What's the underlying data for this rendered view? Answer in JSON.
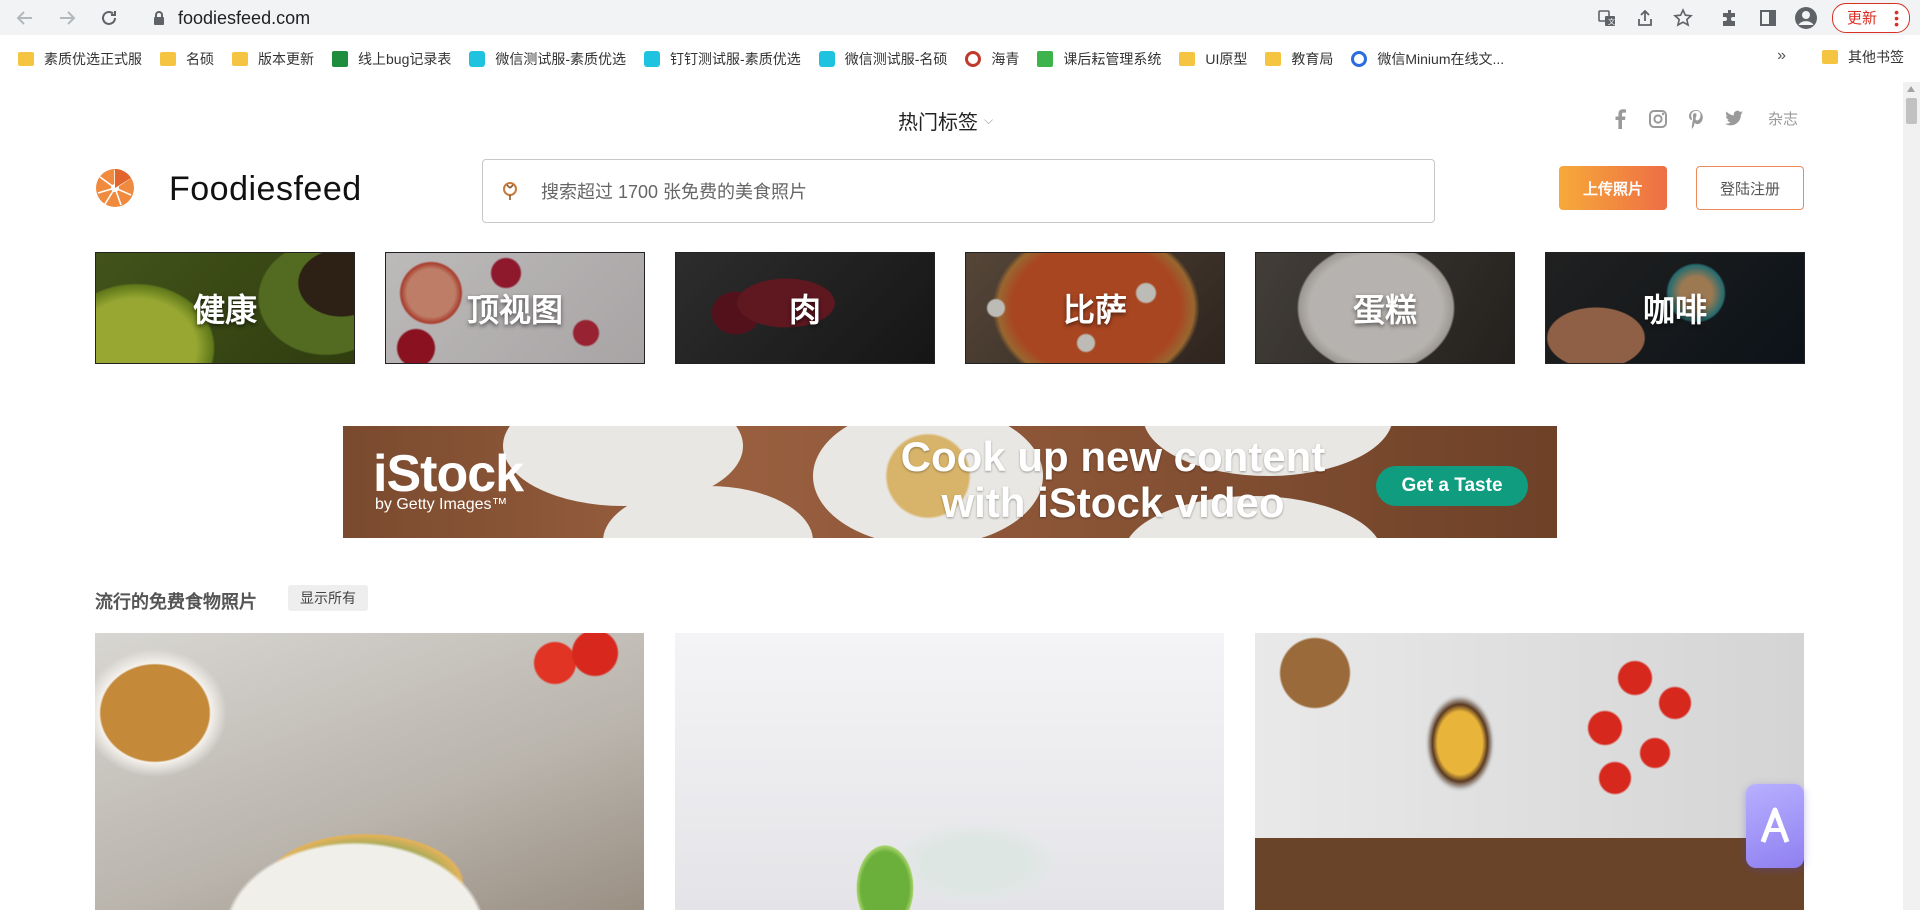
{
  "browser": {
    "url": "foodiesfeed.com",
    "update_label": "更新",
    "bookmarks": [
      {
        "label": "素质优选正式服",
        "icon": "folder-icon",
        "color": "#f5c542"
      },
      {
        "label": "名硕",
        "icon": "folder-icon",
        "color": "#f5c542"
      },
      {
        "label": "版本更新",
        "icon": "folder-icon",
        "color": "#f5c542"
      },
      {
        "label": "线上bug记录表",
        "icon": "sheets-icon",
        "color": "#1e8e3e"
      },
      {
        "label": "微信测试服-素质优选",
        "icon": "app-u-icon",
        "color": "#1fc3e0"
      },
      {
        "label": "钉钉测试服-素质优选",
        "icon": "app-u-icon",
        "color": "#1fc3e0"
      },
      {
        "label": "微信测试服-名硕",
        "icon": "app-u-icon",
        "color": "#1fc3e0"
      },
      {
        "label": "海青",
        "icon": "seal-icon",
        "color": "#c0392b"
      },
      {
        "label": "课后耘管理系统",
        "icon": "green-square-icon",
        "color": "#3cb44b"
      },
      {
        "label": "UI原型",
        "icon": "folder-icon",
        "color": "#f5c542"
      },
      {
        "label": "教育局",
        "icon": "folder-icon",
        "color": "#f5c542"
      },
      {
        "label": "微信Minium在线文...",
        "icon": "circle-logo-icon",
        "color": "#2b6de0"
      }
    ],
    "more_label": "»",
    "other_bookmarks": "其他书签"
  },
  "header": {
    "popular_tags": "热门标签",
    "magazine": "杂志",
    "brand": "Foodiesfeed",
    "search_placeholder": "搜索超过 1700 张免费的美食照片",
    "upload_label": "上传照片",
    "login_label": "登陆注册",
    "accent": "#ef7d3c"
  },
  "categories": [
    {
      "label": "健康"
    },
    {
      "label": "顶视图"
    },
    {
      "label": "肉"
    },
    {
      "label": "比萨"
    },
    {
      "label": "蛋糕"
    },
    {
      "label": "咖啡"
    }
  ],
  "ad": {
    "brand": "iStock",
    "sub": "by Getty Images™",
    "headline_1": "Cook up new content",
    "headline_2": "with iStock video",
    "cta": "Get a Taste"
  },
  "trending": {
    "title": "流行的免费食物照片",
    "show_all": "显示所有"
  }
}
